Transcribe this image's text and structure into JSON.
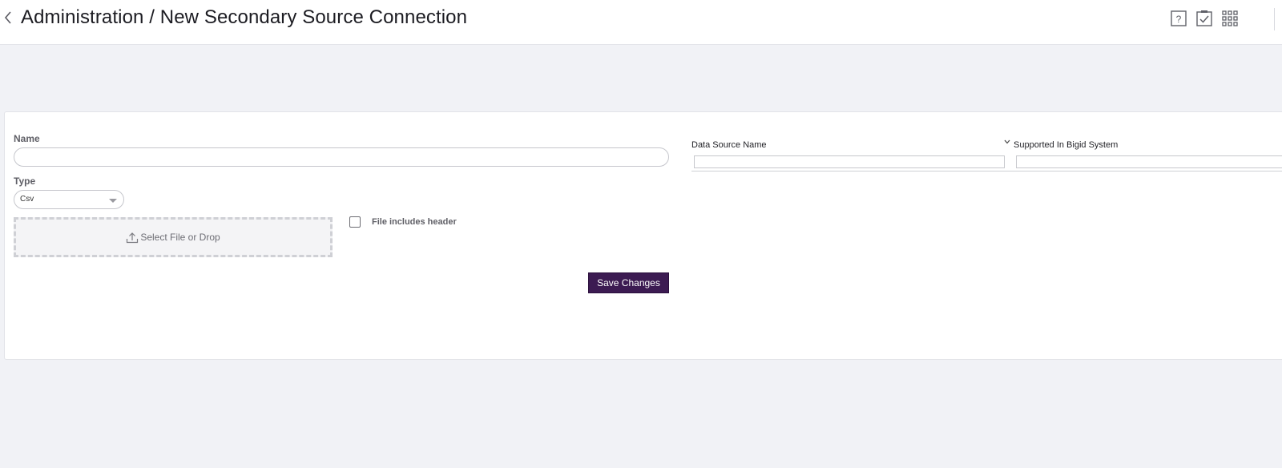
{
  "header": {
    "title": "Administration / New Secondary Source Connection",
    "icons": [
      "chevron-left-icon",
      "help-icon",
      "tasks-icon",
      "apps-grid-icon"
    ]
  },
  "form": {
    "name_label": "Name",
    "name_value": "",
    "type_label": "Type",
    "type_value": "Csv",
    "upload_label": "Select File or Drop",
    "header_checkbox_label": "File includes header",
    "header_checkbox_checked": false,
    "save_label": "Save Changes"
  },
  "grid": {
    "columns": [
      {
        "label": "Data Source Name",
        "filter_value": ""
      },
      {
        "label": "Supported In Bigid System",
        "filter_value": ""
      }
    ]
  },
  "colors": {
    "accent": "#3c1b52",
    "background": "#f1f2f6"
  }
}
